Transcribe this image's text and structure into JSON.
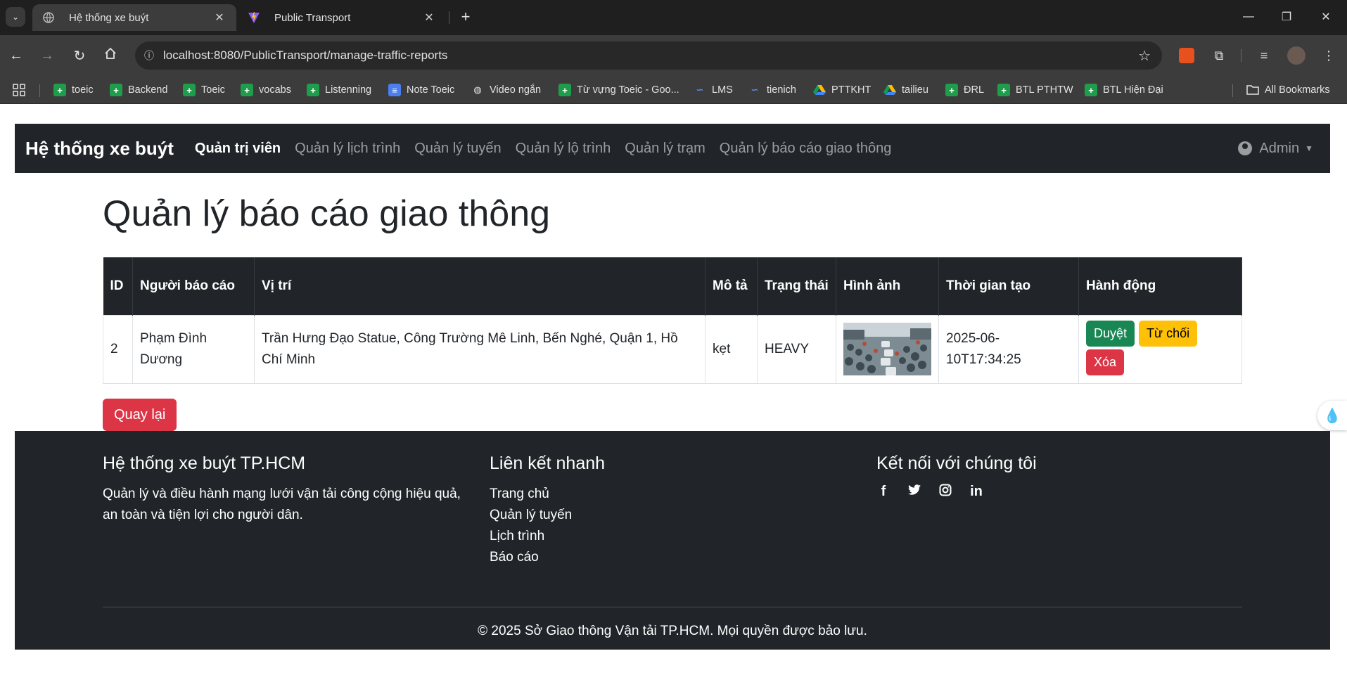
{
  "browser": {
    "tabs": [
      {
        "title": "Hệ thống xe buýt",
        "active": true
      },
      {
        "title": "Public Transport",
        "active": false
      }
    ],
    "url": "localhost:8080/PublicTransport/manage-traffic-reports",
    "bookmarks": [
      {
        "label": "toeic",
        "icon": "sheets-icon"
      },
      {
        "label": "Backend",
        "icon": "sheets-icon"
      },
      {
        "label": "Toeic",
        "icon": "sheets-icon"
      },
      {
        "label": "vocabs",
        "icon": "sheets-icon"
      },
      {
        "label": "Listenning",
        "icon": "sheets-icon"
      },
      {
        "label": "Note Toeic",
        "icon": "docs-icon"
      },
      {
        "label": "Video ngắn",
        "icon": "globe-icon"
      },
      {
        "label": "Từ vựng Toeic - Goo...",
        "icon": "sheets-icon"
      },
      {
        "label": "LMS",
        "icon": "lms-icon"
      },
      {
        "label": "tienich",
        "icon": "lms-icon"
      },
      {
        "label": "PTTKHT",
        "icon": "drive-icon"
      },
      {
        "label": "tailieu",
        "icon": "drive-icon"
      },
      {
        "label": "ĐRL",
        "icon": "sheets-icon"
      },
      {
        "label": "BTL PTHTW",
        "icon": "sheets-icon"
      },
      {
        "label": "BTL Hiện Đại",
        "icon": "sheets-icon"
      }
    ],
    "all_bookmarks": "All Bookmarks"
  },
  "navbar": {
    "brand": "Hệ thống xe buýt",
    "links": [
      "Quản trị viên",
      "Quản lý lịch trình",
      "Quản lý tuyến",
      "Quản lý lộ trình",
      "Quản lý trạm",
      "Quản lý báo cáo giao thông"
    ],
    "user": "Admin"
  },
  "page": {
    "title": "Quản lý báo cáo giao thông",
    "columns": [
      "ID",
      "Người báo cáo",
      "Vị trí",
      "Mô tả",
      "Trạng thái",
      "Hình ảnh",
      "Thời gian tạo",
      "Hành động"
    ],
    "rows": [
      {
        "id": "2",
        "reporter": "Phạm Đình Dương",
        "location": "Trần Hưng Đạo Statue, Công Trường Mê Linh, Bến Nghé, Quận 1, Hồ Chí Minh",
        "description": "kẹt",
        "status": "HEAVY",
        "created_at": "2025-06-10T17:34:25",
        "actions": {
          "approve": "Duyệt",
          "reject": "Từ chối",
          "delete": "Xóa"
        }
      }
    ],
    "back_button": "Quay lại"
  },
  "footer": {
    "about_title": "Hệ thống xe buýt TP.HCM",
    "about_text": "Quản lý và điều hành mạng lưới vận tải công cộng hiệu quả, an toàn và tiện lợi cho người dân.",
    "links_title": "Liên kết nhanh",
    "links": [
      "Trang chủ",
      "Quản lý tuyến",
      "Lịch trình",
      "Báo cáo"
    ],
    "social_title": "Kết nối với chúng tôi",
    "social": [
      "facebook-icon",
      "twitter-icon",
      "instagram-icon",
      "linkedin-icon"
    ],
    "copyright": "© 2025 Sở Giao thông Vận tải TP.HCM. Mọi quyền được bảo lưu."
  }
}
